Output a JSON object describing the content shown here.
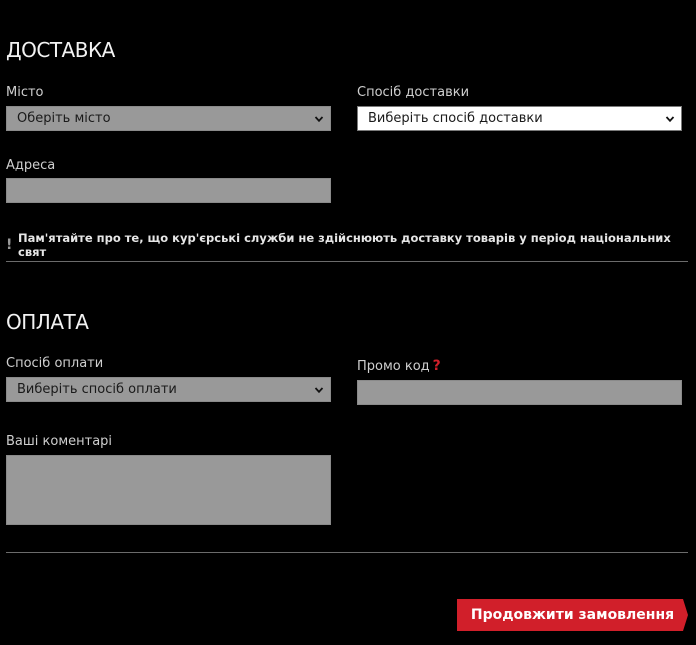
{
  "delivery": {
    "title": "ДОСТАВКА",
    "city_label": "Місто",
    "city_value": "Оберіть місто",
    "method_label": "Спосіб доставки",
    "method_value": "Виберіть спосіб доставки",
    "address_label": "Адреса",
    "address_value": "",
    "notice_icon": "!",
    "notice_text": "Пам'ятайте про те, що кур'єрські служби не здійснюють доставку товарів у період національних свят"
  },
  "payment": {
    "title": "ОПЛАТА",
    "method_label": "Спосіб оплати",
    "method_value": "Виберіть спосіб оплати",
    "promo_label": "Промо код",
    "promo_help_icon": "?",
    "promo_value": "",
    "comments_label": "Ваші коментарі",
    "comments_value": ""
  },
  "actions": {
    "continue_label": "Продовжити замовлення"
  },
  "colors": {
    "background": "#000000",
    "field_gray": "#999999",
    "accent_red": "#d11f2a"
  },
  "icons": {
    "dropdown": "chevron-down-icon",
    "help": "question-mark-icon",
    "notice": "exclamation-icon"
  }
}
